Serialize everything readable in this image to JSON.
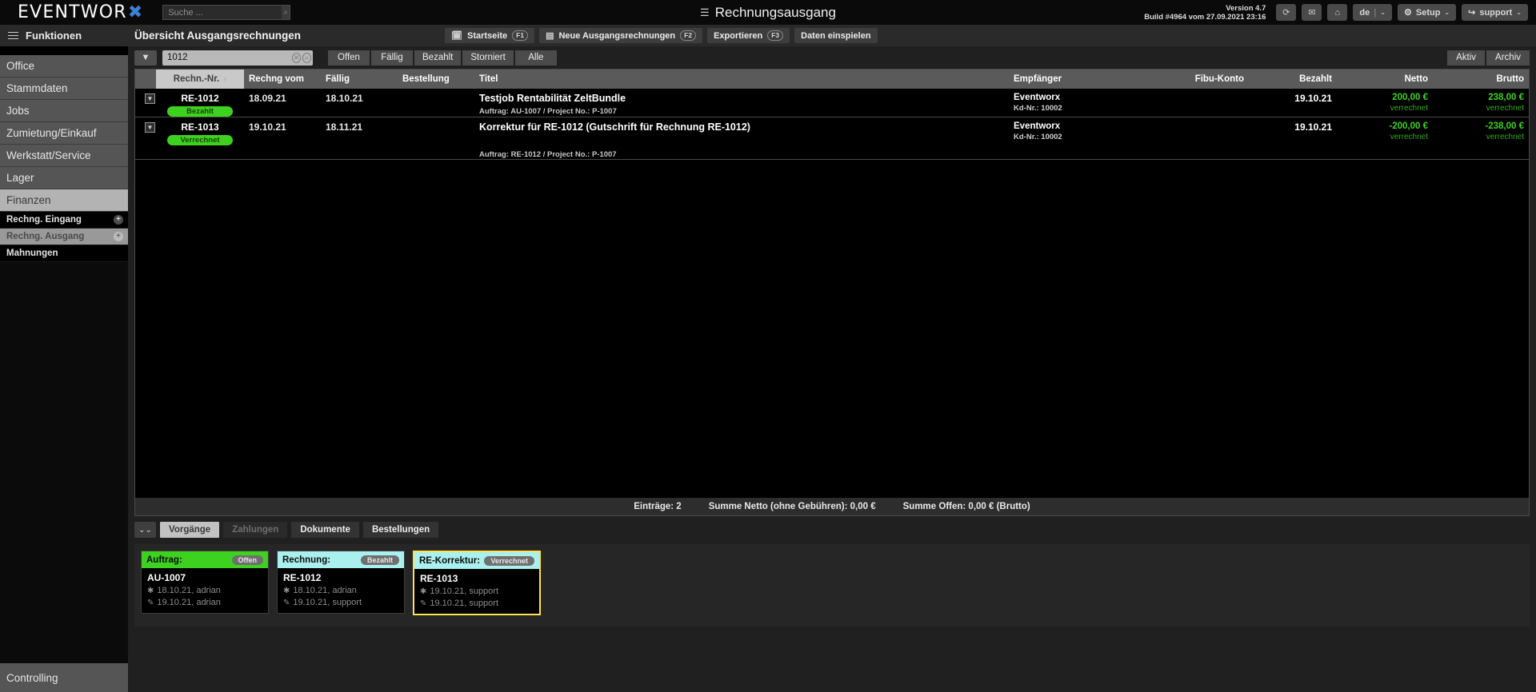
{
  "topbar": {
    "logo_text": "EVENTWOR",
    "logo_x": "✖",
    "search_placeholder": "Suche ...",
    "search_value": "",
    "search_icon": "search-icon",
    "center_title": "Rechnungsausgang",
    "center_icon": "list-icon",
    "version_line1": "Version 4.7",
    "version_line2": "Build #4964 vom 27.09.2021 23:16",
    "buttons": [
      {
        "name": "refresh-button",
        "icon": "⟳"
      },
      {
        "name": "mail-button",
        "icon": "✉"
      },
      {
        "name": "home-button",
        "icon": "⌂"
      }
    ],
    "language": "de",
    "setup_label": "Setup",
    "setup_icon": "⚙",
    "user_label": "support",
    "user_icon": "↪",
    "carat": "⌄"
  },
  "sidebar": {
    "header": "Funktionen",
    "items": [
      {
        "label": "Office"
      },
      {
        "label": "Stammdaten"
      },
      {
        "label": "Jobs"
      },
      {
        "label": "Zumietung/Einkauf"
      },
      {
        "label": "Werkstatt/Service"
      },
      {
        "label": "Lager"
      },
      {
        "label": "Finanzen"
      }
    ],
    "sub_items": [
      {
        "label": "Rechng. Eingang",
        "plus": "+"
      },
      {
        "label": "Rechng. Ausgang",
        "plus": "+"
      },
      {
        "label": "Mahnungen",
        "plus": ""
      }
    ],
    "bottom": "Controlling"
  },
  "nav": {
    "page_title": "Übersicht Ausgangsrechnungen",
    "buttons": [
      {
        "label": "Startseite",
        "fkey": "F1",
        "icon": "🗓"
      },
      {
        "label": "Neue Ausgangsrechnungen",
        "fkey": "F2",
        "icon": "▤"
      },
      {
        "label": "Exportieren",
        "fkey": "F3",
        "icon": ""
      },
      {
        "label": "Daten einspielen",
        "fkey": "",
        "icon": ""
      }
    ]
  },
  "filter": {
    "funnel_icon": "▼",
    "input_value": "1012",
    "clear_icon": "✕",
    "search_icon": "⌕",
    "tabs": [
      "Offen",
      "Fällig",
      "Bezahlt",
      "Storniert",
      "Alle"
    ],
    "archive_tabs": [
      "Aktiv",
      "Archiv"
    ]
  },
  "table": {
    "sort_arrow": "↑",
    "columns": [
      "Rechn.-Nr.",
      "Rechng vom",
      "Fällig",
      "Bestellung",
      "Titel",
      "Empfänger",
      "Fibu-Konto",
      "Bezahlt",
      "Netto",
      "Brutto"
    ],
    "rows": [
      {
        "expander": "▼",
        "nr": "RE-1012",
        "status": "Bezahlt",
        "rechng_vom": "18.09.21",
        "faellig": "18.10.21",
        "bestellung": "",
        "titel": "Testjob Rentabilität ZeltBundle",
        "titel_sub": "Auftrag: AU-1007   /   Project No.: P-1007",
        "empfaenger": "Eventworx",
        "empfaenger_sub": "Kd-Nr.: 10002",
        "fibu": "",
        "bezahlt": "19.10.21",
        "netto": "200,00 €",
        "netto_sub": "verrechnet",
        "brutto": "238,00 €",
        "brutto_sub": "verrechnet"
      },
      {
        "expander": "▼",
        "nr": "RE-1013",
        "status": "Verrechnet",
        "rechng_vom": "19.10.21",
        "faellig": "18.11.21",
        "bestellung": "",
        "titel": "Korrektur für RE-1012 (Gutschrift für Rechnung RE-1012)",
        "titel_sub": "Auftrag: RE-1012   /   Project No.: P-1007",
        "empfaenger": "Eventworx",
        "empfaenger_sub": "Kd-Nr.: 10002",
        "fibu": "",
        "bezahlt": "19.10.21",
        "netto": "-200,00 €",
        "netto_sub": "verrechnet",
        "brutto": "-238,00 €",
        "brutto_sub": "verrechnet"
      }
    ],
    "footer": {
      "entries": "Einträge: 2",
      "sum_netto": "Summe Netto (ohne Gebühren): 0,00 €",
      "sum_offen": "Summe Offen: 0,00 € (Brutto)"
    }
  },
  "bottom_panel": {
    "collapse_icon": "⌄⌄",
    "tabs": [
      {
        "label": "Vorgänge",
        "state": "active"
      },
      {
        "label": "Zahlungen",
        "state": "disabled"
      },
      {
        "label": "Dokumente",
        "state": "normal"
      },
      {
        "label": "Bestellungen",
        "state": "normal"
      }
    ],
    "cards": [
      {
        "title": "Auftrag:",
        "badge": "Offen",
        "head_color": "#3dd21f",
        "id": "AU-1007",
        "created": "18.10.21, adrian",
        "modified": "19.10.21, adrian",
        "selected": false
      },
      {
        "title": "Rechnung:",
        "badge": "Bezahlt",
        "head_color": "#a9f0ef",
        "id": "RE-1012",
        "created": "18.10.21, adrian",
        "modified": "19.10.21, support",
        "selected": false
      },
      {
        "title": "RE-Korrektur:",
        "badge": "Verrechnet",
        "head_color": "#a9f0ef",
        "id": "RE-1013",
        "created": "19.10.21, support",
        "modified": "19.10.21, support",
        "selected": true
      }
    ],
    "star_icon": "✱",
    "pencil_icon": "✎"
  },
  "colors": {
    "accent_green": "#3dd21f",
    "brand_blue": "#3d7fd6",
    "yellow_select": "#ffe14d"
  }
}
